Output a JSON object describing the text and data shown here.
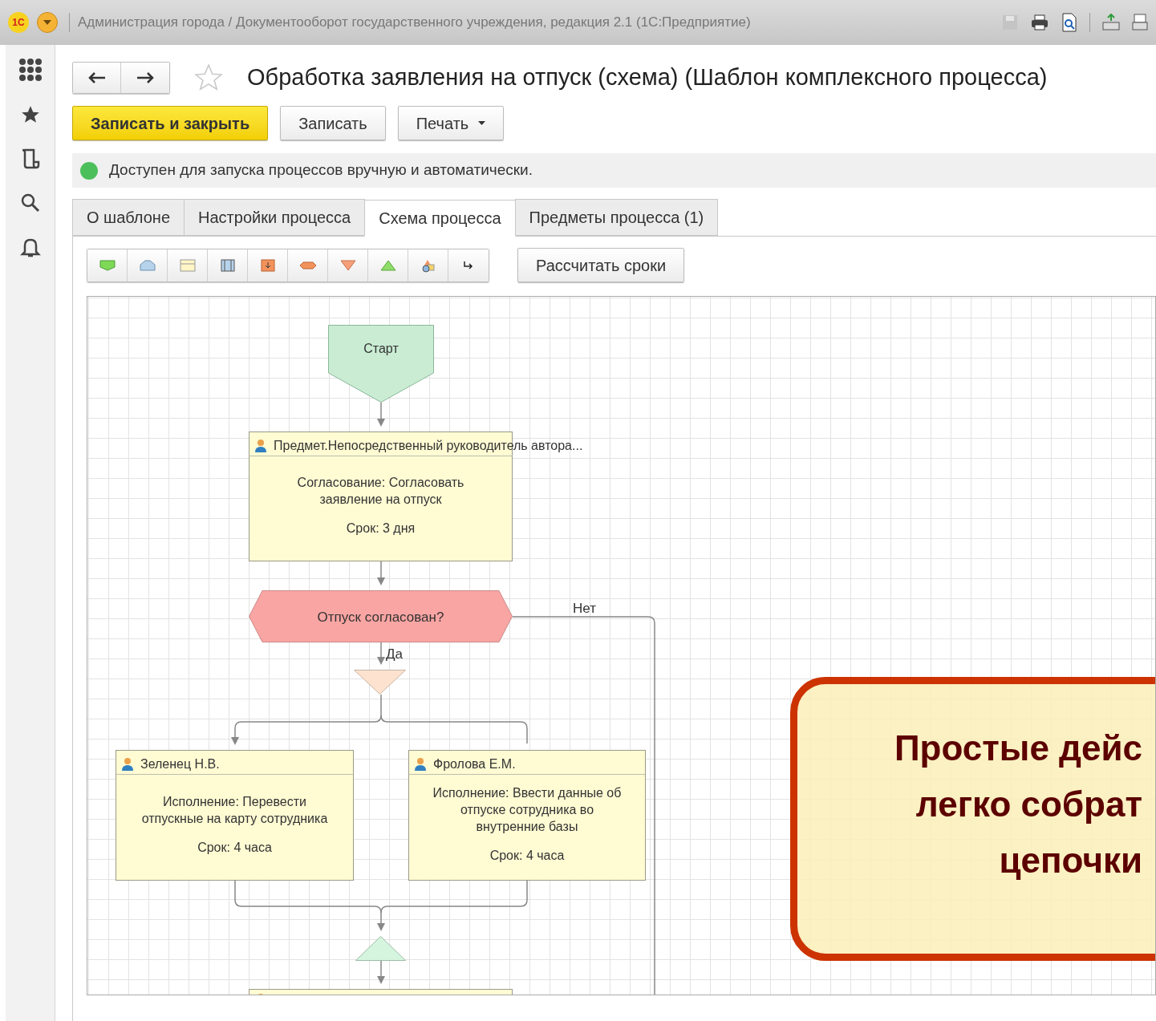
{
  "title_bar": {
    "logo_text": "1С",
    "title": "Администрация города / Документооборот государственного учреждения, редакция 2.1  (1С:Предприятие)"
  },
  "header": {
    "title": "Обработка заявления на отпуск (схема) (Шаблон комплексного процесса)"
  },
  "commands": [
    {
      "label": "Записать и закрыть",
      "kind": "primary"
    },
    {
      "label": "Записать",
      "kind": "plain"
    },
    {
      "label": "Печать",
      "kind": "dropdown"
    }
  ],
  "status": {
    "text": "Доступен для запуска процессов вручную и автоматически."
  },
  "tabs": [
    {
      "label": "О шаблоне",
      "selected": false
    },
    {
      "label": "Настройки процесса",
      "selected": false
    },
    {
      "label": "Схема процесса",
      "selected": true
    },
    {
      "label": "Предметы процесса (1)",
      "selected": false
    }
  ],
  "diagram_toolbar": {
    "button": "Рассчитать сроки"
  },
  "diagram": {
    "nodes": [
      {
        "kind": "start",
        "label": "Старт"
      },
      {
        "kind": "task",
        "performer": "Предмет.Непосредственный  руководитель  автора...",
        "action": "Согласование: Согласовать\nзаявление на отпуск",
        "deadline": "Срок: 3 дня"
      },
      {
        "kind": "decision",
        "label": "Отпуск согласован?"
      },
      {
        "kind": "split"
      },
      {
        "kind": "task",
        "performer": "Зеленец Н.В.",
        "action": "Исполнение: Перевести\nотпускные на карту сотрудника",
        "deadline": "Срок: 4 часа"
      },
      {
        "kind": "task",
        "performer": "Фролова Е.М.",
        "action": "Исполнение: Ввести данные об\nотпуске сотрудника во\nвнутренние базы",
        "deadline": "Срок: 4 часа"
      },
      {
        "kind": "join"
      },
      {
        "kind": "task_partial"
      }
    ],
    "edge_labels": [
      "Нет",
      "Да"
    ]
  },
  "callout": {
    "text": "Простые дейс\nлегко собрат\nцепочки"
  }
}
